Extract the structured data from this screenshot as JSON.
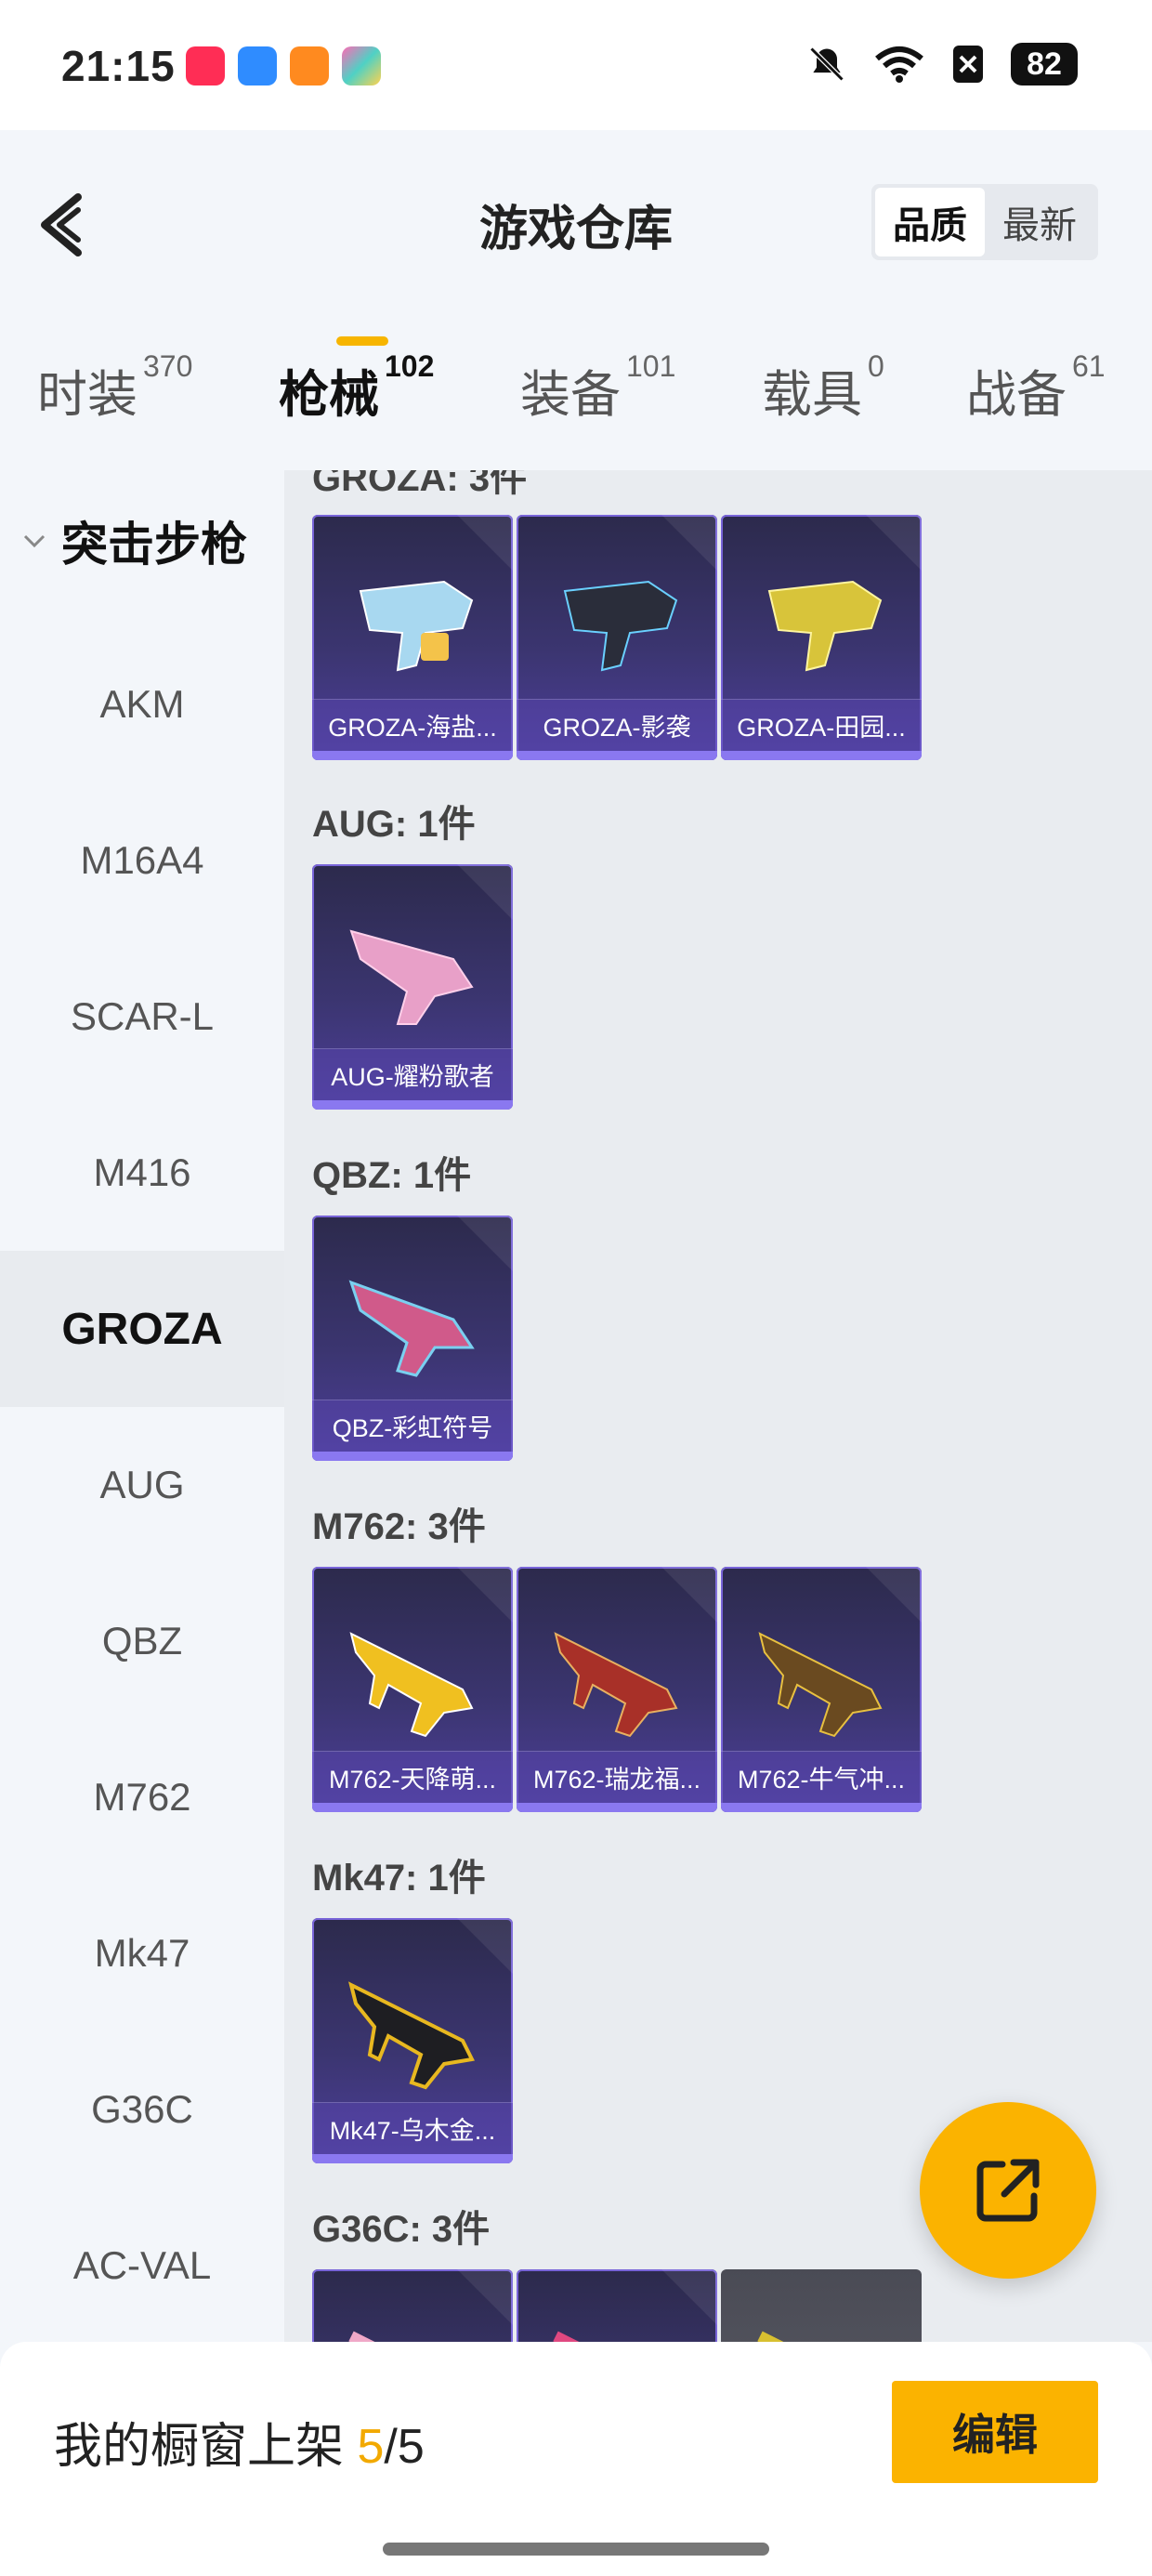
{
  "status": {
    "time": "21:15",
    "battery": "82"
  },
  "header": {
    "title": "游戏仓库",
    "sort_options": [
      "品质",
      "最新"
    ]
  },
  "tabs": [
    {
      "label": "时装",
      "count": "370"
    },
    {
      "label": "枪械",
      "count": "102"
    },
    {
      "label": "装备",
      "count": "101"
    },
    {
      "label": "载具",
      "count": "0"
    },
    {
      "label": "战备",
      "count": "61"
    }
  ],
  "sidebar": {
    "group": "突击步枪",
    "items": [
      "AKM",
      "M16A4",
      "SCAR-L",
      "M416",
      "GROZA",
      "AUG",
      "QBZ",
      "M762",
      "Mk47",
      "G36C",
      "AC-VAL"
    ]
  },
  "sections": [
    {
      "title": "GROZA: 3件",
      "items": [
        "GROZA-海盐...",
        "GROZA-影袭",
        "GROZA-田园..."
      ]
    },
    {
      "title": "AUG: 1件",
      "items": [
        "AUG-耀粉歌者"
      ]
    },
    {
      "title": "QBZ: 1件",
      "items": [
        "QBZ-彩虹符号"
      ]
    },
    {
      "title": "M762: 3件",
      "items": [
        "M762-天降萌...",
        "M762-瑞龙福...",
        "M762-牛气冲..."
      ]
    },
    {
      "title": "Mk47: 1件",
      "items": [
        "Mk47-乌木金..."
      ]
    },
    {
      "title": "G36C: 3件",
      "items": [
        "",
        "",
        ""
      ]
    }
  ],
  "bottom": {
    "shelf_label": "我的橱窗上架",
    "shelf_count": "5",
    "shelf_sep": "/",
    "shelf_total": "5",
    "edit_label": "编辑"
  },
  "colors": {
    "accent": "#fbb300",
    "card_bg": "#3b3570",
    "card_border": "#7864d8"
  },
  "icons": [
    "back-arrow-icon",
    "share-export-icon",
    "chevron-down-icon",
    "bell-off-icon",
    "wifi-icon"
  ]
}
